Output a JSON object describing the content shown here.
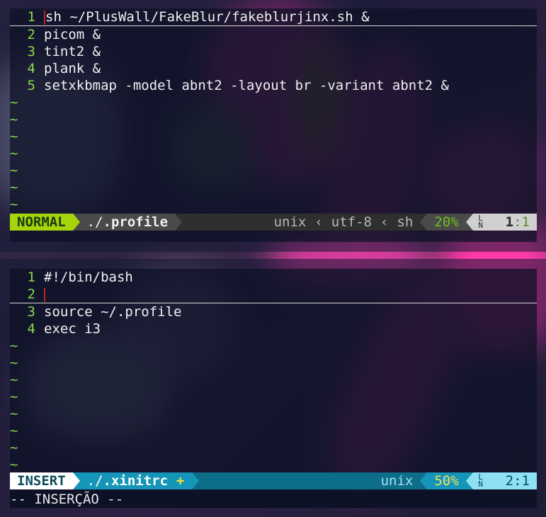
{
  "top_editor": {
    "lines": [
      {
        "num": "1",
        "text": "sh ~/PlusWall/FakeBlur/fakeblurjinx.sh &"
      },
      {
        "num": "2",
        "text": "picom &"
      },
      {
        "num": "3",
        "text": "tint2 &"
      },
      {
        "num": "4",
        "text": "plank &"
      },
      {
        "num": "5",
        "text": "setxkbmap -model abnt2 -layout br -variant abnt2 &"
      }
    ],
    "tilde": "~",
    "status": {
      "mode": "NORMAL",
      "path_prefix": "./",
      "filename": ".profile",
      "fileformat": "unix",
      "encoding": "utf-8",
      "filetype": "sh",
      "percent": "20%",
      "ln_symbol": "LN",
      "line": "1",
      "col": ":1"
    }
  },
  "bottom_editor": {
    "lines": [
      {
        "num": "1",
        "text": "#!/bin/bash"
      },
      {
        "num": "2",
        "text": ""
      },
      {
        "num": "3",
        "text": "source ~/.profile"
      },
      {
        "num": "4",
        "text": "exec i3"
      }
    ],
    "tilde": "~",
    "status": {
      "mode": "INSERT",
      "path_prefix": "./",
      "filename": ".xinitrc",
      "modified": "+",
      "fileformat": "unix",
      "percent": "50%",
      "ln_symbol": "LN",
      "position": "2:1"
    }
  },
  "cmdline": "-- INSERÇÃO --",
  "colors": {
    "accent_green": "#8bd94a",
    "normal_mode_bg": "#a6d40a",
    "insert_mode_bg": "#ffffff",
    "insert_bar": "#0d6e8a",
    "insert_percent_bg": "#1596b8"
  }
}
